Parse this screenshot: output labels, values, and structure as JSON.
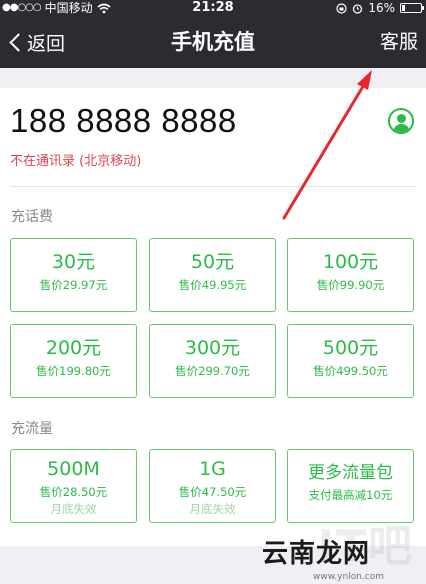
{
  "status_bar": {
    "signal": "●●○○○",
    "carrier": "中国移动",
    "time": "21:28",
    "battery_percent": "16%",
    "battery_level": 0.16
  },
  "nav": {
    "back_label": "返回",
    "title": "手机充值",
    "service_label": "客服"
  },
  "account": {
    "phone_number": "188 8888 8888",
    "carrier_info": "不在通讯录 (北京移动)"
  },
  "recharge": {
    "section_label": "充话费",
    "options": [
      {
        "amount": "30元",
        "price": "售价29.97元"
      },
      {
        "amount": "50元",
        "price": "售价49.95元"
      },
      {
        "amount": "100元",
        "price": "售价99.90元"
      },
      {
        "amount": "200元",
        "price": "售价199.80元"
      },
      {
        "amount": "300元",
        "price": "售价299.70元"
      },
      {
        "amount": "500元",
        "price": "售价499.50元"
      }
    ]
  },
  "data_plans": {
    "section_label": "充流量",
    "options": [
      {
        "amount": "500M",
        "price": "售价28.50元",
        "note": "月底失效"
      },
      {
        "amount": "1G",
        "price": "售价47.50元",
        "note": "月底失效"
      }
    ],
    "more": {
      "title": "更多流量包",
      "subtitle": "支付最高减10元"
    }
  },
  "watermark": {
    "logo": "云南龙网",
    "url": "www.ynlon.com"
  },
  "colors": {
    "accent": "#2dbb48",
    "warning": "#e1454c",
    "nav_bg": "#2b2c31",
    "arrow": "#e8262b"
  }
}
